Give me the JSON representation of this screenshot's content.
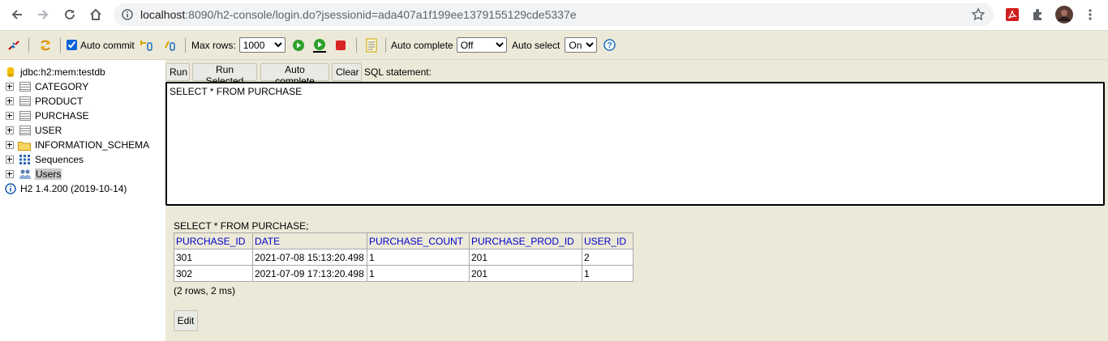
{
  "browser": {
    "url_host": "localhost",
    "url_rest": ":8090/h2-console/login.do?jsessionid=ada407a1f199ee1379155129cde5337e"
  },
  "toolbar": {
    "auto_commit_label": "Auto commit",
    "auto_commit_checked": true,
    "max_rows_label": "Max rows:",
    "max_rows_value": "1000",
    "auto_complete_label": "Auto complete",
    "auto_complete_value": "Off",
    "auto_select_label": "Auto select",
    "auto_select_value": "On"
  },
  "tree": {
    "connection": "jdbc:h2:mem:testdb",
    "items": [
      {
        "label": "CATEGORY",
        "icon": "table-icon"
      },
      {
        "label": "PRODUCT",
        "icon": "table-icon"
      },
      {
        "label": "PURCHASE",
        "icon": "table-icon"
      },
      {
        "label": "USER",
        "icon": "table-icon"
      },
      {
        "label": "INFORMATION_SCHEMA",
        "icon": "folder-icon"
      },
      {
        "label": "Sequences",
        "icon": "sequences-icon"
      },
      {
        "label": "Users",
        "icon": "users-icon"
      }
    ],
    "version": "H2 1.4.200 (2019-10-14)"
  },
  "query": {
    "run_label": "Run",
    "run_selected_label": "Run Selected",
    "auto_complete_label": "Auto complete",
    "clear_label": "Clear",
    "sql_statement_label": "SQL statement:",
    "sql_text": "SELECT * FROM PURCHASE"
  },
  "results": {
    "statement": "SELECT * FROM PURCHASE;",
    "columns": [
      "PURCHASE_ID",
      "DATE",
      "PURCHASE_COUNT",
      "PURCHASE_PROD_ID",
      "USER_ID"
    ],
    "rows": [
      [
        "301",
        "2021-07-08 15:13:20.498",
        "1",
        "201",
        "2"
      ],
      [
        "302",
        "2021-07-09 17:13:20.498",
        "1",
        "201",
        "1"
      ]
    ],
    "summary": "(2 rows, 2 ms)",
    "edit_label": "Edit"
  }
}
